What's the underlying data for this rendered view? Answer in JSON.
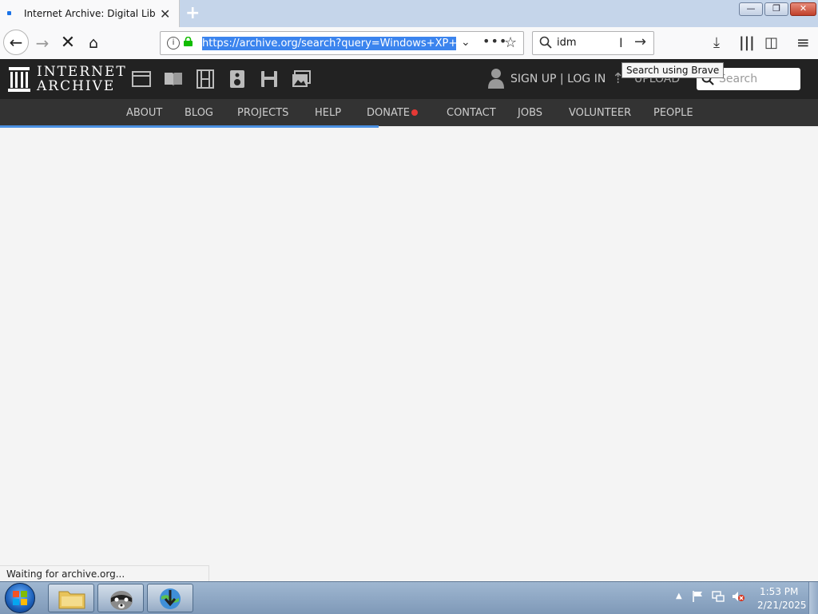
{
  "browser": {
    "tab_title": "Internet Archive: Digital Library",
    "url": "https://archive.org/search?query=Windows+XP+Fo",
    "search_value": "idm",
    "search_tooltip": "Search using Brave",
    "status_text": "Waiting for archive.org..."
  },
  "site": {
    "logo_line1": "INTERNET",
    "logo_line2": "ARCHIVE",
    "signup_label": "SIGN UP | LOG IN",
    "upload_label": "UPLOAD",
    "search_placeholder": "Search",
    "nav": [
      "ABOUT",
      "BLOG",
      "PROJECTS",
      "HELP",
      "DONATE",
      "CONTACT",
      "JOBS",
      "VOLUNTEER",
      "PEOPLE"
    ]
  },
  "taskbar": {
    "time": "1:53 PM",
    "date": "2/21/2025"
  },
  "colors": {
    "header_bg": "#222222",
    "nav_bg": "#333333",
    "progress": "#4a90e2",
    "donate_dot": "#e53935"
  }
}
